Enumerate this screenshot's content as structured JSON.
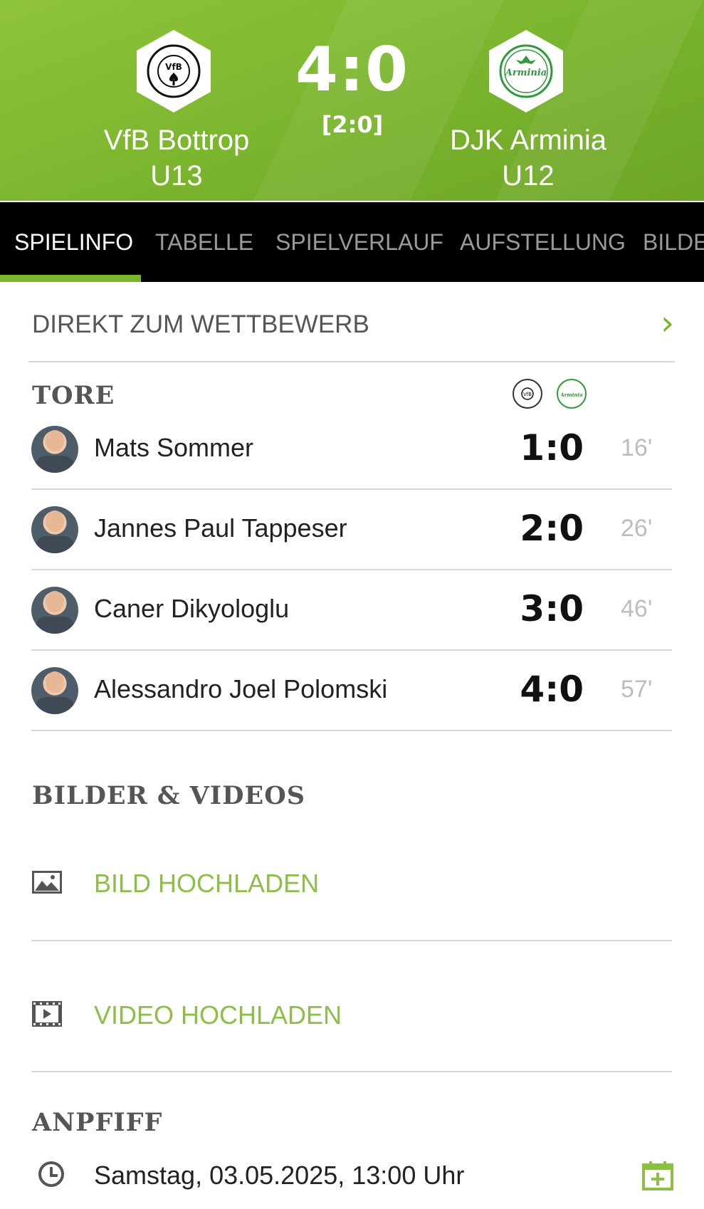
{
  "match": {
    "home_team_line1": "VfB Bottrop",
    "home_team_line2": "U13",
    "away_team_line1": "DJK Arminia",
    "away_team_line2": "U12",
    "score": "4:0",
    "halftime": "[2:0]",
    "home_logo_text": "BOTTROP 1900 VfB",
    "away_logo_text": "DJK Arminia"
  },
  "tabs": [
    {
      "label": "SPIELINFO",
      "active": true
    },
    {
      "label": "TABELLE",
      "active": false
    },
    {
      "label": "SPIELVERLAUF",
      "active": false
    },
    {
      "label": "AUFSTELLUNG",
      "active": false
    },
    {
      "label": "BILDE",
      "active": false
    }
  ],
  "competition_link": "DIREKT ZUM WETTBEWERB",
  "goals_section": {
    "title": "TORE",
    "goals": [
      {
        "player": "Mats Sommer",
        "score": "1:0",
        "minute": "16'"
      },
      {
        "player": "Jannes Paul Tappeser",
        "score": "2:0",
        "minute": "26'"
      },
      {
        "player": "Caner Dikyologlu",
        "score": "3:0",
        "minute": "46'"
      },
      {
        "player": "Alessandro Joel Polomski",
        "score": "4:0",
        "minute": "57'"
      }
    ]
  },
  "media_section": {
    "title": "BILDER & VIDEOS",
    "upload_image": "BILD HOCHLADEN",
    "upload_video": "VIDEO HOCHLADEN"
  },
  "kickoff": {
    "title": "ANPFIFF",
    "datetime": "Samstag, 03.05.2025, 13:00 Uhr"
  },
  "colors": {
    "accent": "#7ab52f",
    "header_green": "#84bc35",
    "tab_bar": "#000000"
  }
}
